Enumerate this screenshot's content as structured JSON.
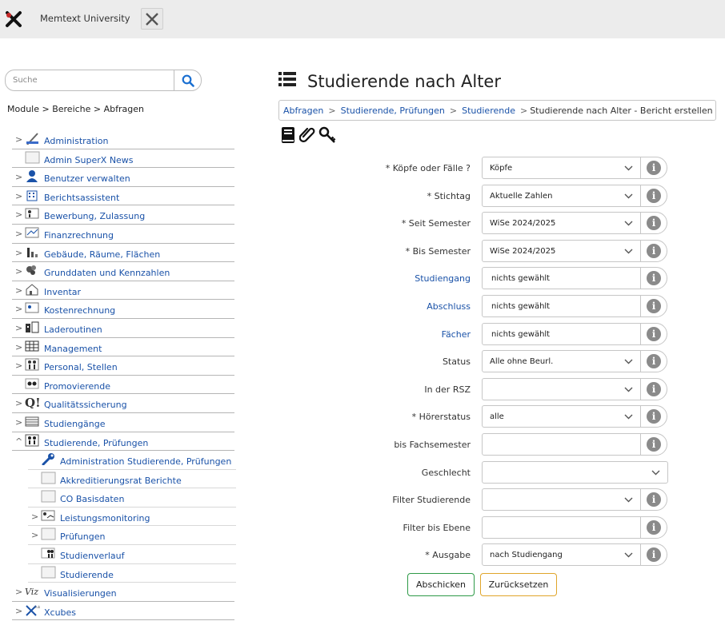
{
  "header": {
    "university": "Memtext University",
    "close_icon": "close-x-icon"
  },
  "search": {
    "placeholder": "Suche",
    "icon": "search-icon"
  },
  "nav_crumb": "Module > Bereiche > Abfragen",
  "tree": {
    "items": [
      {
        "label": "Administration",
        "arrow": ">",
        "icon": "admin-icon"
      },
      {
        "label": "Admin SuperX News",
        "arrow": "",
        "icon": "blank-icon"
      },
      {
        "label": "Benutzer verwalten",
        "arrow": ">",
        "icon": "user-icon"
      },
      {
        "label": "Berichtsassistent",
        "arrow": ">",
        "icon": "building-icon"
      },
      {
        "label": "Bewerbung, Zulassung",
        "arrow": ">",
        "icon": "people-icon"
      },
      {
        "label": "Finanzrechnung",
        "arrow": ">",
        "icon": "chart-icon"
      },
      {
        "label": "Gebäude, Räume, Flächen",
        "arrow": ">",
        "icon": "bar-icon"
      },
      {
        "label": "Grunddaten und Kennzahlen",
        "arrow": ">",
        "icon": "cluster-icon"
      },
      {
        "label": "Inventar",
        "arrow": ">",
        "icon": "house-icon"
      },
      {
        "label": "Kostenrechnung",
        "arrow": ">",
        "icon": "card-icon"
      },
      {
        "label": "Laderoutinen",
        "arrow": ">",
        "icon": "loader-icon"
      },
      {
        "label": "Management",
        "arrow": ">",
        "icon": "grid-icon"
      },
      {
        "label": "Personal, Stellen",
        "arrow": ">",
        "icon": "persons-icon"
      },
      {
        "label": "Promovierende",
        "arrow": "",
        "icon": "glasses-icon"
      },
      {
        "label": "Qualitätssicherung",
        "arrow": ">",
        "icon": "quality-icon"
      },
      {
        "label": "Studiengänge",
        "arrow": ">",
        "icon": "list-icon"
      },
      {
        "label": "Studierende, Prüfungen",
        "arrow": "^",
        "icon": "students-icon"
      }
    ],
    "sub_items": [
      {
        "label": "Administration Studierende, Prüfungen",
        "arrow": "",
        "icon": "wrench-icon"
      },
      {
        "label": "Akkreditierungsrat Berichte",
        "arrow": "",
        "icon": "blank-icon"
      },
      {
        "label": "CO Basisdaten",
        "arrow": "",
        "icon": "blank-icon"
      },
      {
        "label": "Leistungsmonitoring",
        "arrow": ">",
        "icon": "monitor-icon"
      },
      {
        "label": "Prüfungen",
        "arrow": ">",
        "icon": "blank-icon"
      },
      {
        "label": "Studienverlauf",
        "arrow": "",
        "icon": "course-icon"
      },
      {
        "label": "Studierende",
        "arrow": "",
        "icon": "blank-icon"
      }
    ],
    "bottom_items": [
      {
        "label": "Visualisierungen",
        "arrow": ">",
        "icon": "viz-icon"
      },
      {
        "label": "Xcubes",
        "arrow": ">",
        "icon": "xcubes-icon"
      }
    ]
  },
  "main": {
    "title": "Studierende nach Alter",
    "breadcrumb": {
      "links": [
        "Abfragen",
        "Studierende, Prüfungen",
        "Studierende"
      ],
      "separator": ">",
      "current": "Studierende nach Alter - Bericht erstellen"
    },
    "tools": [
      "book-icon",
      "paperclip-icon",
      "keys-icon"
    ],
    "fields": [
      {
        "label": "* Köpfe oder Fälle ?",
        "value": "Köpfe",
        "kind": "select",
        "link": false
      },
      {
        "label": "* Stichtag",
        "value": "Aktuelle Zahlen",
        "kind": "select",
        "link": false
      },
      {
        "label": "* Seit Semester",
        "value": "WiSe 2024/2025",
        "kind": "select",
        "link": false
      },
      {
        "label": "* Bis Semester",
        "value": "WiSe 2024/2025",
        "kind": "select",
        "link": false
      },
      {
        "label": "Studiengang",
        "value": "nichts gewählt",
        "kind": "text",
        "link": true
      },
      {
        "label": "Abschluss",
        "value": "nichts gewählt",
        "kind": "text",
        "link": true
      },
      {
        "label": "Fächer",
        "value": "nichts gewählt",
        "kind": "text",
        "link": true
      },
      {
        "label": "Status",
        "value": "Alle ohne Beurl.",
        "kind": "select",
        "link": false
      },
      {
        "label": "In der RSZ",
        "value": "",
        "kind": "select",
        "link": false
      },
      {
        "label": "* Hörerstatus",
        "value": "alle",
        "kind": "select",
        "link": false
      },
      {
        "label": "bis Fachsemester",
        "value": "",
        "kind": "input",
        "link": false
      },
      {
        "label": "Geschlecht",
        "value": "",
        "kind": "wide-select",
        "link": false
      },
      {
        "label": "Filter Studierende",
        "value": "",
        "kind": "select",
        "link": false
      },
      {
        "label": "Filter bis Ebene",
        "value": "",
        "kind": "input",
        "link": false
      },
      {
        "label": "* Ausgabe",
        "value": "nach Studiengang",
        "kind": "select",
        "link": false
      }
    ],
    "info_glyph": "i",
    "submit_label": "Abschicken",
    "reset_label": "Zurücksetzen"
  }
}
